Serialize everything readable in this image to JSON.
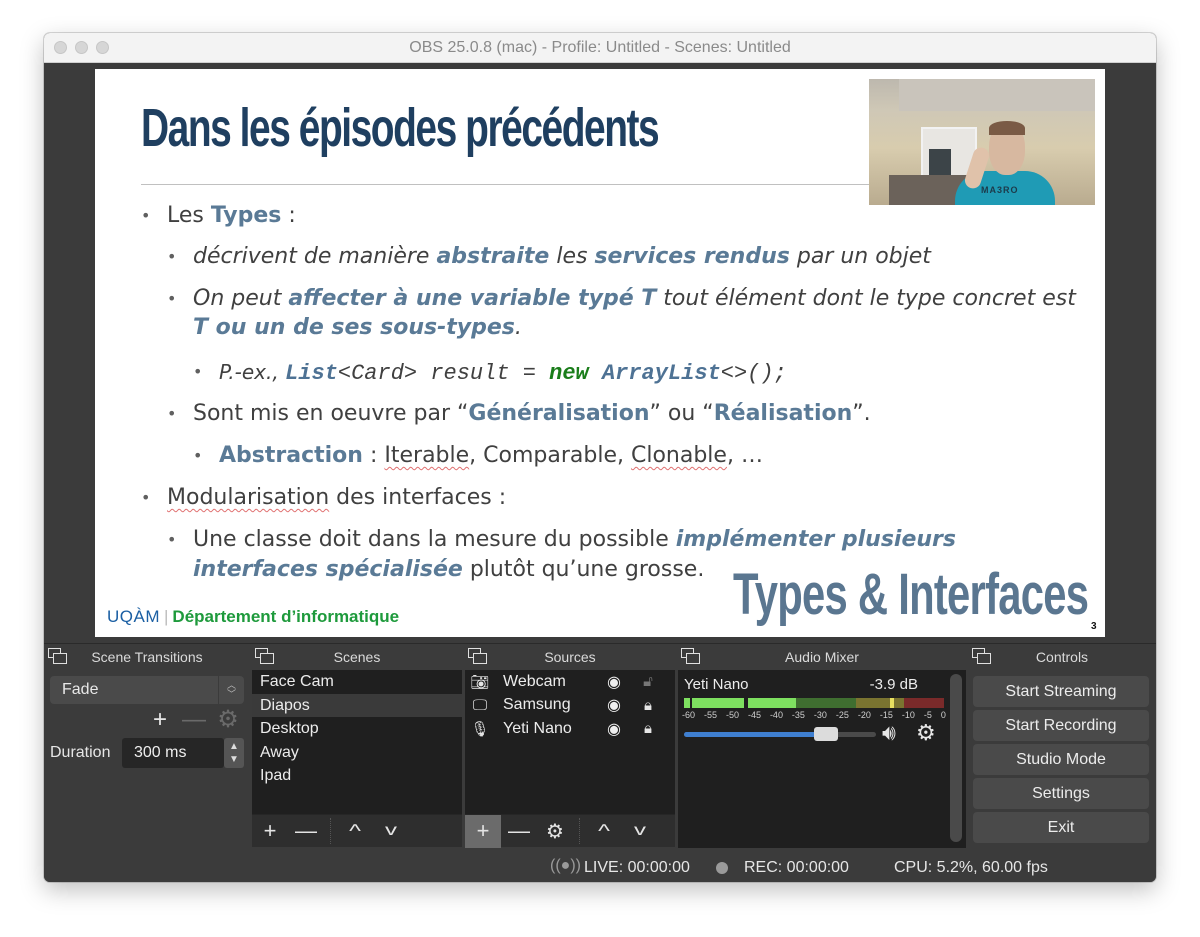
{
  "window": {
    "title": "OBS 25.0.8 (mac) - Profile: Untitled - Scenes: Untitled"
  },
  "slide": {
    "title": "Dans les épisodes précédents",
    "bullets": {
      "l1a_pre": "Les ",
      "l1a_hl": "Types",
      "l1a_post": " :",
      "l2a_pre": "décrivent de manière ",
      "l2a_hl1": "abstraite",
      "l2a_mid": " les ",
      "l2a_hl2": "services rendus",
      "l2a_post": " par un objet",
      "l2b_pre": "On peut ",
      "l2b_hl": "affecter à une variable typé T",
      "l2b_post": " tout élément dont le type concret est",
      "l2b_line2_hl": "T ou un de ses sous-types",
      "l2b_line2_post": ".",
      "l3a_pre": "P.-ex., ",
      "l3a_code1": "List",
      "l3a_code2": "<Card> result = ",
      "l3a_code3": "new",
      "l3a_code4": " ",
      "l3a_code5": "ArrayList",
      "l3a_code6": "<>();",
      "l2c_pre": "Sont mis en oeuvre par “",
      "l2c_hl1": "Généralisation",
      "l2c_mid": "” ou “",
      "l2c_hl2": "Réalisation",
      "l2c_post": "”.",
      "l3b_hl": "Abstraction",
      "l3b_mid": " : ",
      "l3b_w1": "Iterable",
      "l3b_w2": ", Comparable, ",
      "l3b_w3": "Clonable",
      "l3b_post": ", …",
      "l1b_w1": "Modularisation",
      "l1b_post": " des interfaces :",
      "l2d_pre": "Une classe doit dans la mesure du possible ",
      "l2d_hl": "implémenter plusieurs",
      "l2d_line2_hl": "interfaces spécialisée",
      "l2d_line2_post": " plutôt qu’une grosse."
    },
    "footer_uqam": "UQÀM",
    "footer_sep": "|",
    "footer_dept": "Département d’informatique",
    "tag": "Types & Interfaces",
    "page_number": "3",
    "webcam_shirt_text": "MA3RO"
  },
  "docks": {
    "scene_transitions": {
      "title": "Scene Transitions",
      "transition_value": "Fade",
      "duration_label": "Duration",
      "duration_value": "300 ms"
    },
    "scenes": {
      "title": "Scenes",
      "items": [
        "Face Cam",
        "Diapos",
        "Desktop",
        "Away",
        "Ipad"
      ],
      "selected": "Diapos"
    },
    "sources": {
      "title": "Sources",
      "items": [
        {
          "name": "Webcam",
          "icon": "camera-icon",
          "visible": true,
          "locked": false
        },
        {
          "name": "Samsung",
          "icon": "monitor-icon",
          "visible": true,
          "locked": true
        },
        {
          "name": "Yeti Nano",
          "icon": "microphone-icon",
          "visible": true,
          "locked": true
        }
      ]
    },
    "audio_mixer": {
      "title": "Audio Mixer",
      "channel_name": "Yeti Nano",
      "level": "-3.9 dB",
      "volume_fraction": 0.74,
      "scale": [
        "-60",
        "-55",
        "-50",
        "-45",
        "-40",
        "-35",
        "-30",
        "-25",
        "-20",
        "-15",
        "-10",
        "-5",
        "0"
      ]
    },
    "controls": {
      "title": "Controls",
      "buttons": [
        "Start Streaming",
        "Start Recording",
        "Studio Mode",
        "Settings",
        "Exit"
      ]
    }
  },
  "statusbar": {
    "live": "LIVE: 00:00:00",
    "rec": "REC: 00:00:00",
    "cpu": "CPU: 5.2%, 60.00 fps"
  },
  "colors": {
    "slide_title": "#1f3f60",
    "highlight": "#5a7a96",
    "code_green": "#1a7d1a",
    "uqam_blue": "#1b5fa3",
    "dept_green": "#1e9a3c",
    "meter_green": "#7ee060",
    "meter_yellow": "#d7c84a",
    "meter_red": "#b83a3a",
    "volume_blue": "#3f7fd0"
  }
}
